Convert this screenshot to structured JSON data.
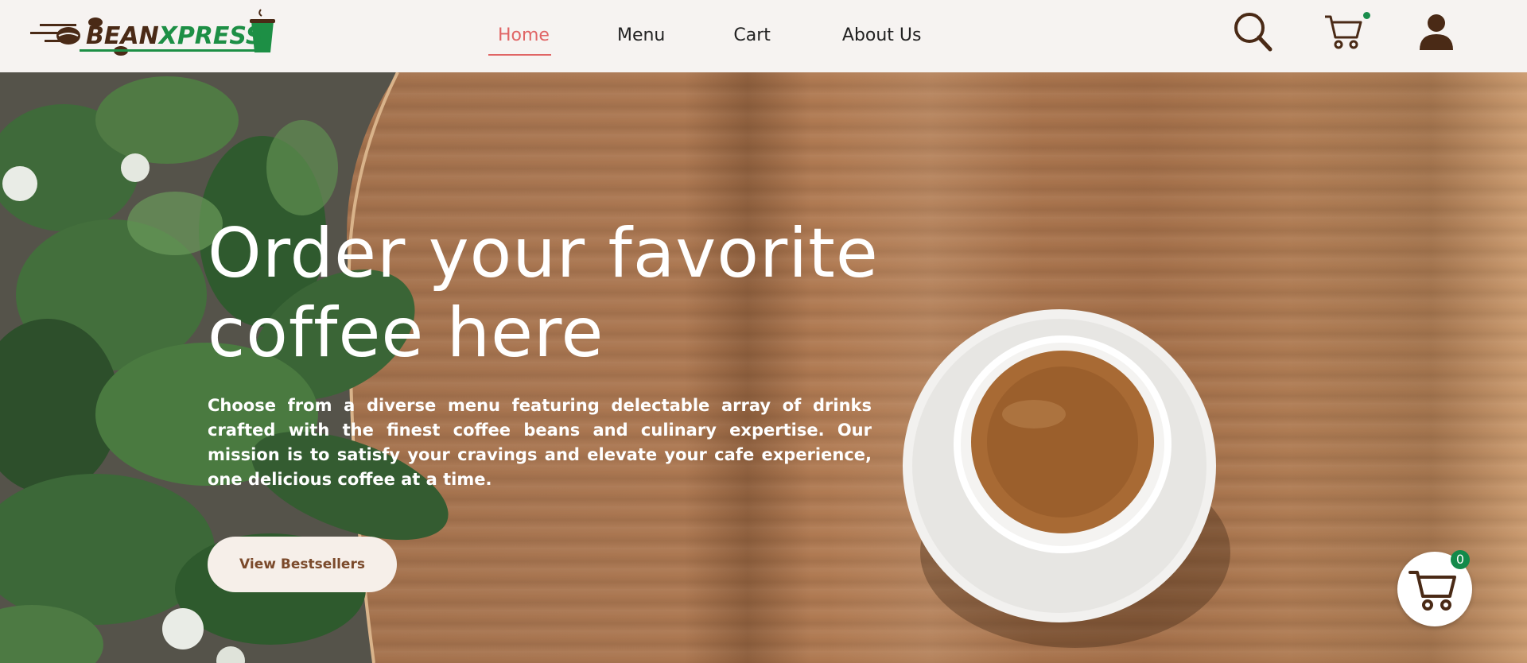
{
  "brand": {
    "logo_part1": "BEAN",
    "logo_part2": "XPRESS",
    "logo_icon": "coffee-cup-icon",
    "colors": {
      "brown": "#4a2a16",
      "green": "#1d8f45"
    }
  },
  "nav": {
    "items": [
      {
        "label": "Home",
        "active": true
      },
      {
        "label": "Menu"
      },
      {
        "label": "Cart"
      },
      {
        "label": "About Us"
      }
    ],
    "active_color": "#e06565"
  },
  "header_icons": [
    "search-icon",
    "cart-icon",
    "user-icon"
  ],
  "hero": {
    "title_line1": "Order your favorite",
    "title_line2": "coffee here",
    "description": "Choose from a diverse menu featuring delectable array of drinks crafted with the finest coffee beans and culinary expertise. Our mission is to satisfy your cravings and elevate your cafe experience, one delicious coffee at a time.",
    "cta_label": "View Bestsellers"
  },
  "floating_cart": {
    "count": "0",
    "badge_color": "#138a4a"
  }
}
